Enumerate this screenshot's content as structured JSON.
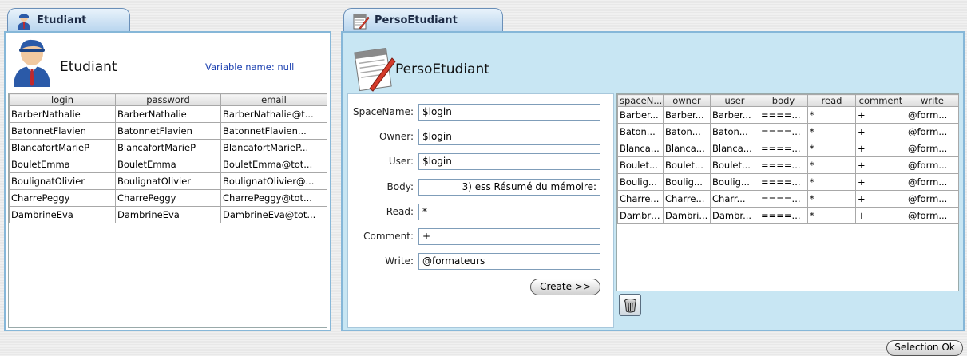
{
  "left": {
    "tab_label": "Etudiant",
    "title": "Etudiant",
    "variable_name": "Variable name: null",
    "columns": [
      "login",
      "password",
      "email"
    ],
    "rows": [
      [
        "BarberNathalie",
        "BarberNathalie",
        "BarberNathalie@t..."
      ],
      [
        "BatonnetFlavien",
        "BatonnetFlavien",
        "BatonnetFlavien..."
      ],
      [
        "BlancafortMarieP",
        "BlancafortMarieP",
        "BlancafortMarieP..."
      ],
      [
        "BouletEmma",
        "BouletEmma",
        "BouletEmma@tot..."
      ],
      [
        "BoulignatOlivier",
        "BoulignatOlivier",
        "BoulignatOlivier@..."
      ],
      [
        "CharrePeggy",
        "CharrePeggy",
        "CharrePeggy@tot..."
      ],
      [
        "DambrineEva",
        "DambrineEva",
        "DambrineEva@tot..."
      ]
    ]
  },
  "right": {
    "tab_label": "PersoEtudiant",
    "title": "PersoEtudiant",
    "form": {
      "spacename_label": "SpaceName:",
      "spacename_value": "$login",
      "owner_label": "Owner:",
      "owner_value": "$login",
      "user_label": "User:",
      "user_value": "$login",
      "body_label": "Body:",
      "body_value": "3) ess   Résumé du mémoire:",
      "read_label": "Read:",
      "read_value": "*",
      "comment_label": "Comment:",
      "comment_value": "+",
      "write_label": "Write:",
      "write_value": "@formateurs",
      "create_label": "Create >>"
    },
    "columns": [
      "spaceN...",
      "owner",
      "user",
      "body",
      "read",
      "comment",
      "write"
    ],
    "rows": [
      [
        "Barber...",
        "Barber...",
        "Barber...",
        "====...",
        "*",
        "+",
        "@form..."
      ],
      [
        "Baton...",
        "Baton...",
        "Baton...",
        "====...",
        "*",
        "+",
        "@form..."
      ],
      [
        "Blanca...",
        "Blanca...",
        "Blanca...",
        "====...",
        "*",
        "+",
        "@form..."
      ],
      [
        "Boulet...",
        "Boulet...",
        "Boulet...",
        "====...",
        "*",
        "+",
        "@form..."
      ],
      [
        "Boulig...",
        "Boulig...",
        "Boulig...",
        "====...",
        "*",
        "+",
        "@form..."
      ],
      [
        "Charre...",
        "Charre...",
        "Charr...",
        "====...",
        "*",
        "+",
        "@form..."
      ],
      [
        "Dambri...",
        "Dambri...",
        "Dambr...",
        "====...",
        "*",
        "+",
        "@form..."
      ]
    ]
  },
  "footer": {
    "selection_ok_label": "Selection Ok"
  },
  "colors": {
    "panel_border": "#86b7d8",
    "right_panel_bg": "#c8e6f3",
    "variable_name_text": "#1a3fb0"
  }
}
